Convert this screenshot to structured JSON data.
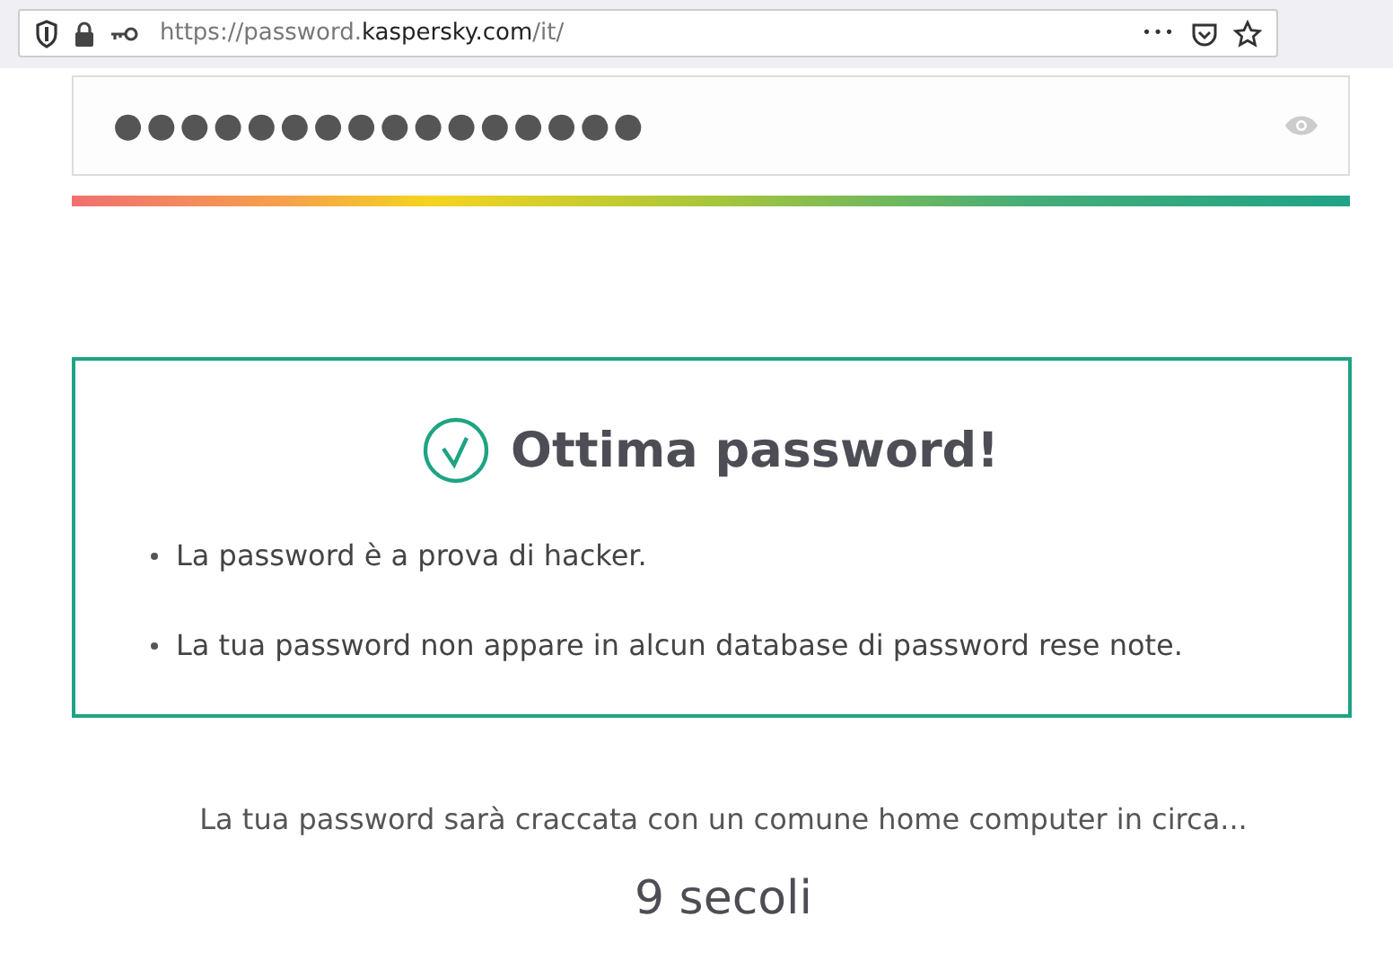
{
  "address_bar": {
    "url_scheme_host": "https://password.",
    "url_domain": "kaspersky.com",
    "url_path": "/it/",
    "more_label": "•••"
  },
  "password_field": {
    "value": "●●●●●●●●●●●●●●●●"
  },
  "strength_meter": {
    "level": 1
  },
  "result": {
    "title": "Ottima password!",
    "points": [
      "La password è a prova di hacker.",
      "La tua password non appare in alcun database di password rese note."
    ]
  },
  "estimate": {
    "text": "La tua password sarà craccata con un comune home computer in circa...",
    "value": "9 secoli"
  }
}
